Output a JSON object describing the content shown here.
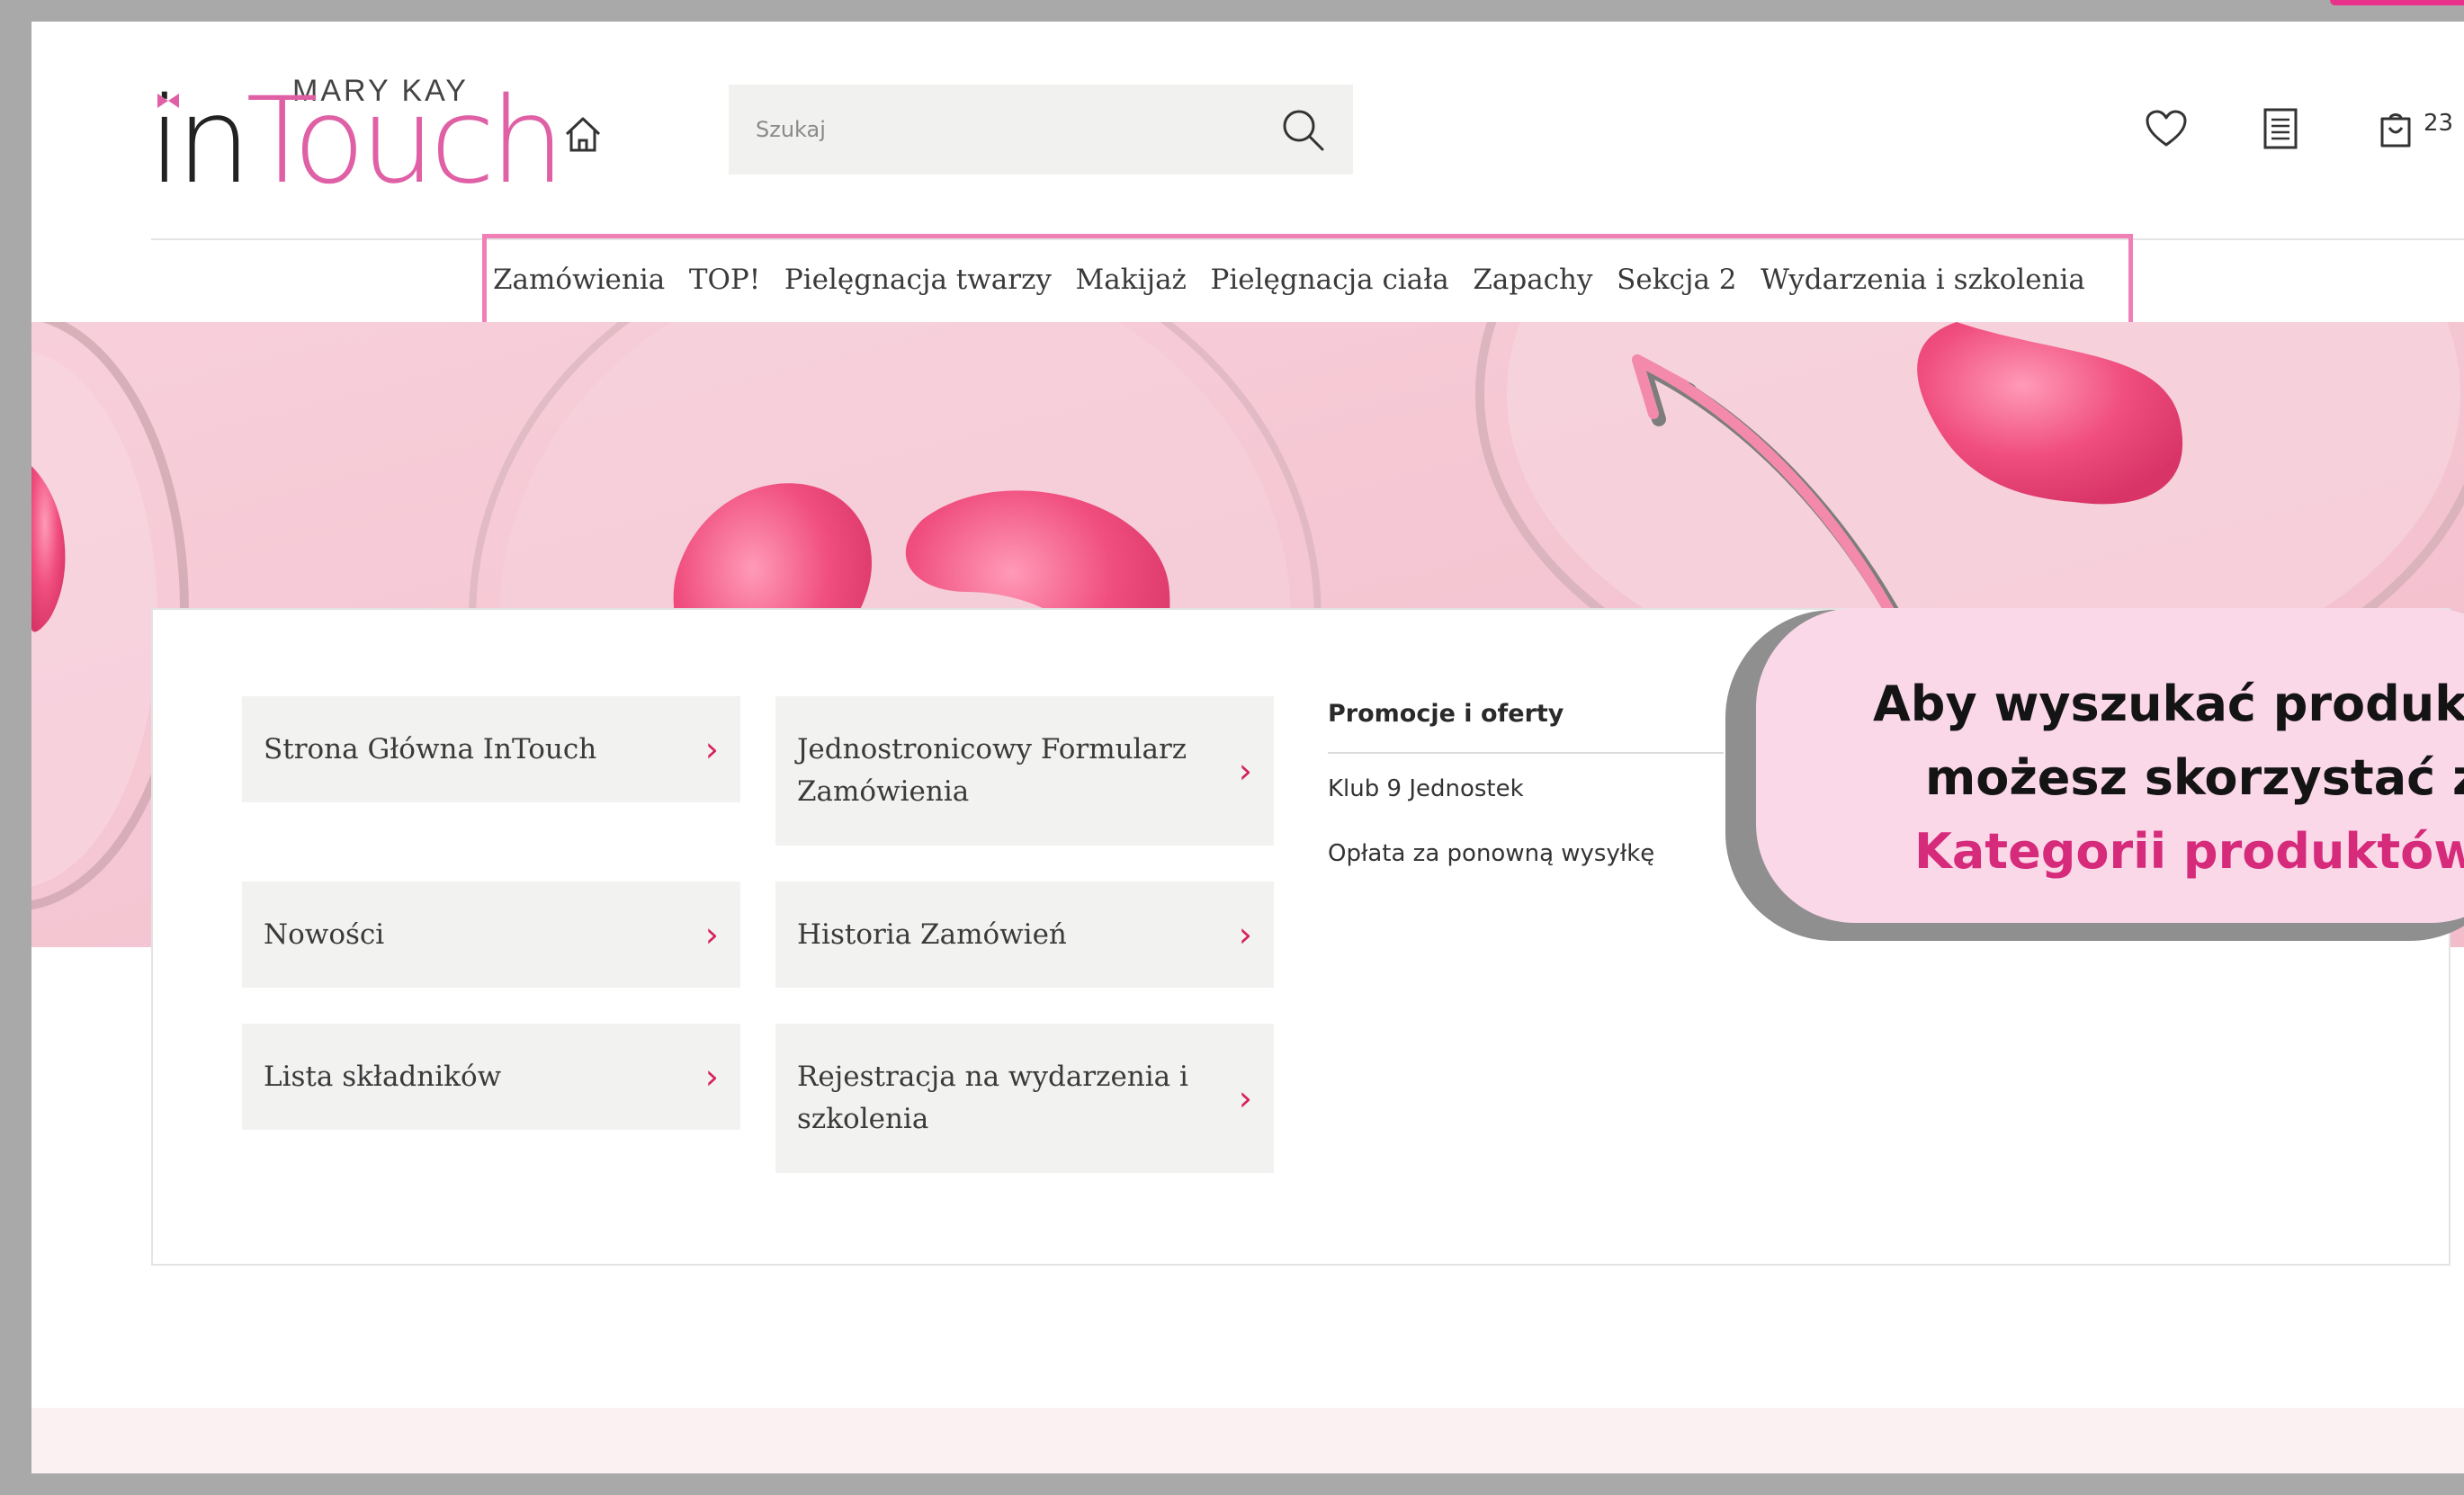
{
  "header": {
    "brand_small": "MARY KAY",
    "brand_main": "inTouch",
    "search": {
      "placeholder": "Szukaj",
      "value": ""
    },
    "cart_count": "23"
  },
  "nav": {
    "items": [
      "Zamówienia",
      "TOP!",
      "Pielęgnacja twarzy",
      "Makijaż",
      "Pielęgnacja ciała",
      "Zapachy",
      "Sekcja 2",
      "Wydarzenia i szkolenia"
    ]
  },
  "tiles": [
    {
      "label": "Strona Główna InTouch"
    },
    {
      "label": "Jednostronicowy Formularz Zamówienia"
    },
    {
      "label": "Nowości"
    },
    {
      "label": "Historia Zamówień"
    },
    {
      "label": "Lista składników"
    },
    {
      "label": "Rejestracja na wydarzenia i szkolenia"
    }
  ],
  "promo": {
    "title": "Promocje i oferty",
    "links": [
      "Klub 9 Jednostek",
      "Opłata za ponowną wysyłkę"
    ]
  },
  "callout": {
    "line1": "Aby wyszukać produkt",
    "line2": "możesz skorzystać z",
    "line3": "Kategorii produktów"
  },
  "colors": {
    "accent_pink": "#d62a7b",
    "highlight_border": "#f07fb5",
    "chevron": "#d6205f",
    "hero": "#f5c9d4"
  },
  "icons": {
    "home": "home-icon",
    "search": "search-icon",
    "wishlist": "heart-icon",
    "orders": "document-list-icon",
    "cart": "shopping-bag-icon",
    "tile_arrow": "chevron-right-icon"
  }
}
